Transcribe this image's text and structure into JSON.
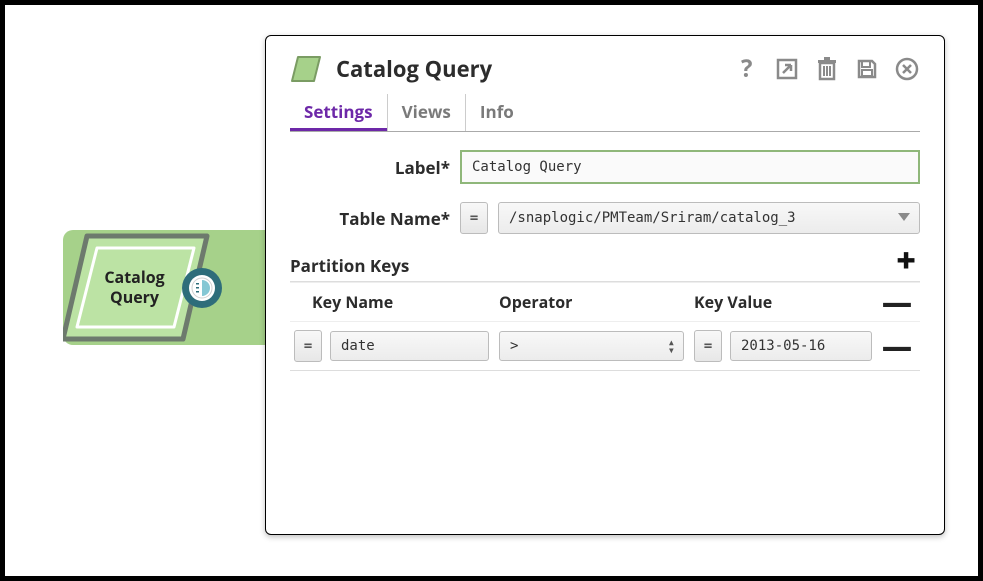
{
  "pipeline": {
    "snap_label": "Catalog Query"
  },
  "dialog": {
    "title": "Catalog Query",
    "tabs": {
      "settings": "Settings",
      "views": "Views",
      "info": "Info"
    },
    "labels": {
      "label": "Label*",
      "table_name": "Table Name*",
      "partition_keys": "Partition Keys"
    },
    "values": {
      "label": "Catalog Query",
      "table_name": "/snaplogic/PMTeam/Sriram/catalog_3"
    },
    "eq_glyph": "=",
    "partition_keys": {
      "headers": {
        "key_name": "Key Name",
        "operator": "Operator",
        "key_value": "Key Value"
      },
      "rows": [
        {
          "key_name": "date",
          "operator": ">",
          "key_value": "2013-05-16"
        }
      ],
      "add_glyph": "+",
      "remove_glyph": "—"
    }
  }
}
